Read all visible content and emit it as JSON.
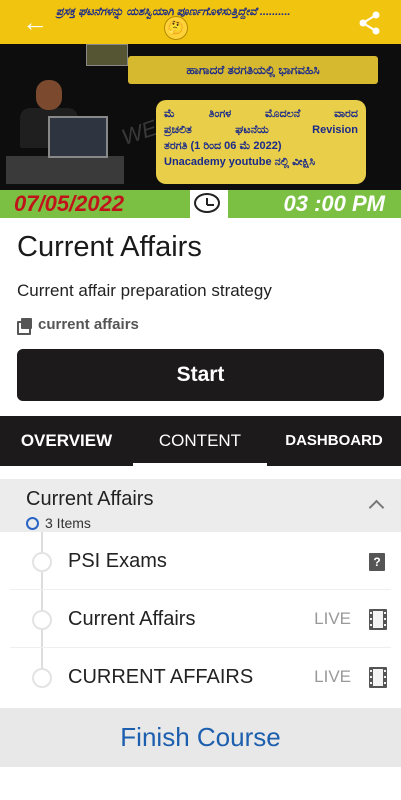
{
  "banner": {
    "top_text": "ಪ್ರಸಕ್ತ ಘಟನೆಗಳನ್ನು ಯಶಸ್ವಿಯಾಗಿ ಪೂರ್ಣಗೊಳಿಸುತ್ತಿದ್ದೇವೆ ..........",
    "tag": "ಹಾಗಾದರೆ ತರಗತಿಯಲ್ಲಿ ಭಾಗವಹಿಸಿ",
    "panel_lines": [
      [
        "ಮೆ",
        "ತಿಂಗಳ",
        "ಮೊದಲನೆ",
        "ವಾರದ"
      ],
      [
        "ಪ್ರಚಲಿತ",
        "ಘಟನೆಯ",
        "Revision"
      ],
      [
        "ತರಗತಿ (1 ರಿಂದ 06 ಮೆ 2022)"
      ],
      [
        "Unacademy youtube ನಲ್ಲಿ ವೀಕ್ಷಿಸಿ"
      ]
    ],
    "watermark": "WE Office",
    "date": "07/05/2022",
    "time": "03 :00 PM"
  },
  "course": {
    "title": "Current Affairs",
    "subtitle": "Current affair preparation strategy",
    "tag": "current affairs",
    "start_label": "Start"
  },
  "tabs": [
    {
      "label": "OVERVIEW",
      "active": false
    },
    {
      "label": "CONTENT",
      "active": true
    },
    {
      "label": "DASHBOARD",
      "active": false
    }
  ],
  "section": {
    "title": "Current Affairs",
    "count": "3 Items",
    "items": [
      {
        "label": "PSI Exams",
        "status": "",
        "icon": "quiz-icon"
      },
      {
        "label": "Current Affairs",
        "status": "LIVE",
        "icon": "video-icon"
      },
      {
        "label": "CURRENT AFFAIRS",
        "status": "LIVE",
        "icon": "video-icon"
      }
    ]
  },
  "footer": {
    "finish_label": "Finish Course"
  },
  "colors": {
    "brand_link": "#1c5fae",
    "tab_bar": "#1c1a1a",
    "date_strip": "#7bc043",
    "banner_yellow": "#f1c40f"
  }
}
